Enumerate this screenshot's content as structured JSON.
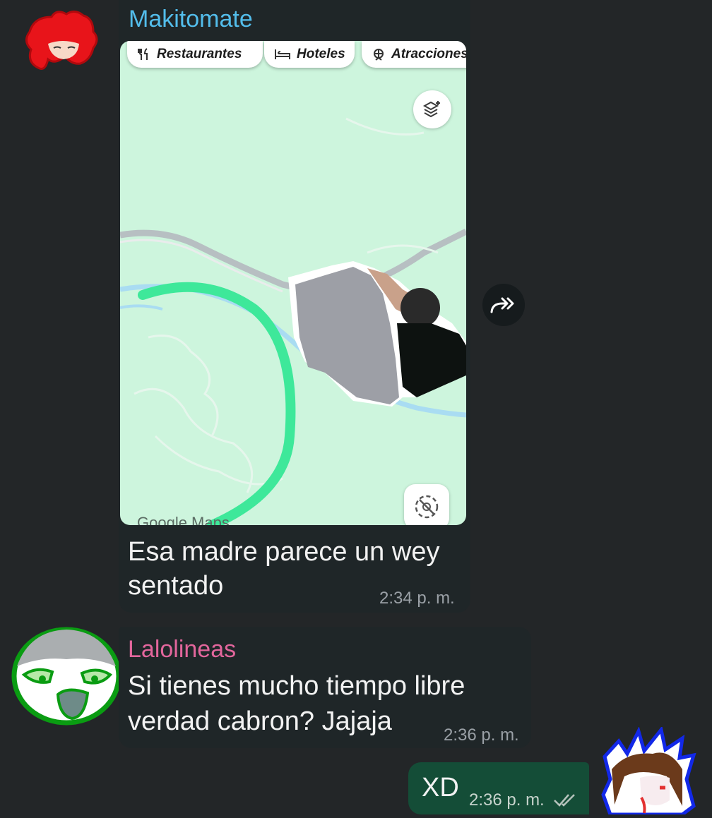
{
  "messages": [
    {
      "sender": "Makitomate",
      "sender_color": "#53bdeb",
      "text_line1": "Esa madre parece un wey",
      "text_line2": "sentado",
      "time": "2:34 p. m."
    },
    {
      "sender": "Lalolineas",
      "sender_color": "#e2669c",
      "text_line1": "Si tienes mucho tiempo libre",
      "text_line2": "verdad cabron? Jajaja",
      "time": "2:36 p. m."
    },
    {
      "text": "XD",
      "time": "2:36 p. m.",
      "status_icon": "double-check-icon"
    }
  ],
  "map": {
    "chips": [
      "Restaurantes",
      "Hoteles",
      "Atracciones"
    ],
    "chip_icons": [
      "fork-knife-icon",
      "bed-icon",
      "ferris-wheel-icon"
    ],
    "watermark": "Google Maps",
    "background_color": "#cdf5dd",
    "route_color": "#3ee89a"
  },
  "colors": {
    "app_background": "#232628",
    "incoming_bubble": "#1f2628",
    "outgoing_bubble": "#144d37"
  }
}
